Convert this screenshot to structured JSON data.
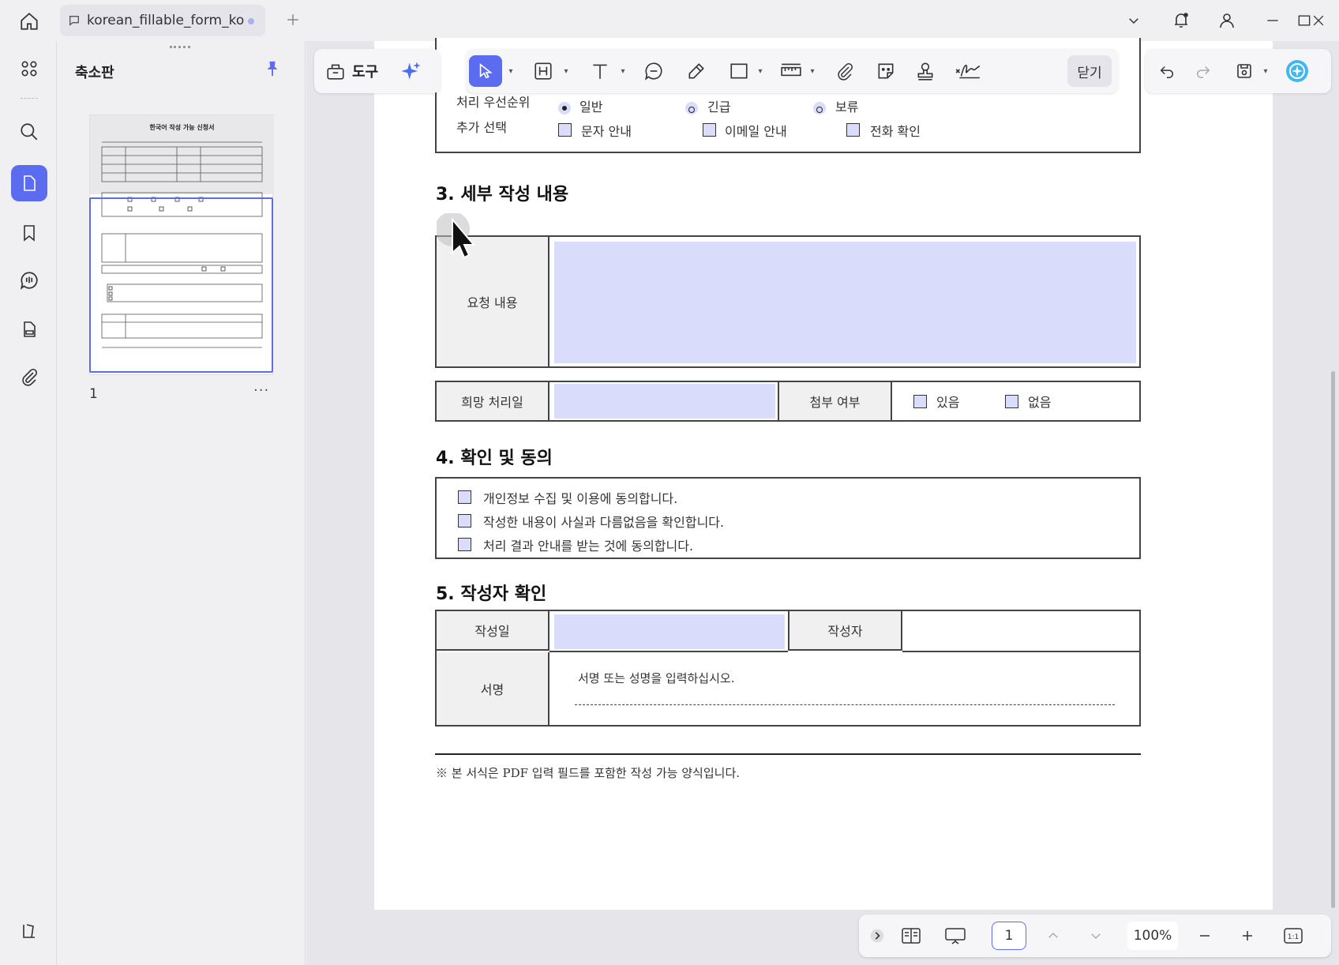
{
  "tab": {
    "title": "korean_fillable_form_ko"
  },
  "panel": {
    "title": "축소판",
    "page_number": "1",
    "more": "···"
  },
  "thumbnail": {
    "title": "한국어 작성 가능 신청서"
  },
  "toolbar": {
    "tools_label": "도구",
    "close_label": "닫기"
  },
  "form": {
    "priority": {
      "label": "처리 우선순위",
      "options": [
        "일반",
        "긴급",
        "보류"
      ],
      "selected": "일반"
    },
    "extra": {
      "label": "추가 선택",
      "options": [
        "문자 안내",
        "이메일 안내",
        "전화 확인"
      ]
    },
    "section3": {
      "title": "3. 세부 작성 내용",
      "request_label": "요청 내용",
      "desired_date_label": "희망 처리일",
      "attachment_label": "첨부 여부",
      "attachment_options": [
        "있음",
        "없음"
      ]
    },
    "section4": {
      "title": "4. 확인 및 동의",
      "items": [
        "개인정보 수집 및 이용에 동의합니다.",
        "작성한 내용이 사실과 다름없음을 확인합니다.",
        "처리 결과 안내를 받는 것에 동의합니다."
      ]
    },
    "section5": {
      "title": "5. 작성자 확인",
      "date_label": "작성일",
      "author_label": "작성자",
      "signature_label": "서명",
      "signature_hint": "서명 또는 성명을 입력하십시오."
    },
    "footnote": "※ 본 서식은 PDF 입력 필드를 포함한 작성 가능 양식입니다."
  },
  "bottombar": {
    "page": "1",
    "zoom": "100%"
  },
  "colors": {
    "accent": "#5b6cf0",
    "field_fill": "#d9dcfa",
    "label_fill": "#f0f0f0"
  }
}
